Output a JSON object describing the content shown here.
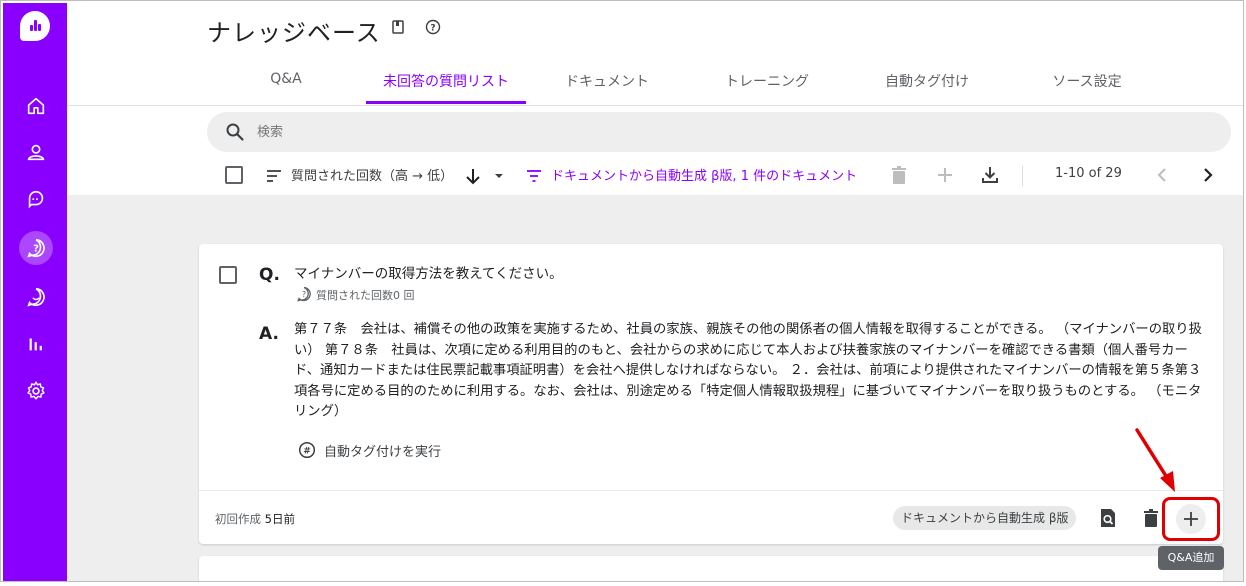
{
  "sidebar": {
    "items": [
      {
        "icon": "home-icon"
      },
      {
        "icon": "user-icon"
      },
      {
        "icon": "chat-icon"
      },
      {
        "icon": "question-icon"
      },
      {
        "icon": "smile-chat-icon"
      },
      {
        "icon": "chart-icon"
      },
      {
        "icon": "gear-icon"
      }
    ],
    "active_index": 3,
    "accent_color": "#8a00ff"
  },
  "header": {
    "title": "ナレッジベース",
    "tabs": [
      {
        "label": "Q&A"
      },
      {
        "label": "未回答の質問リスト"
      },
      {
        "label": "ドキュメント"
      },
      {
        "label": "トレーニング"
      },
      {
        "label": "自動タグ付け"
      },
      {
        "label": "ソース設定"
      }
    ],
    "active_tab": 1
  },
  "toolbar": {
    "search_placeholder": "検索",
    "sort_label": "質問された回数（高 → 低）",
    "filter_label": "ドキュメントから自動生成 β版, 1 件のドキュメント",
    "pagination": "1-10 of 29"
  },
  "card": {
    "q_mark": "Q.",
    "question": "マイナンバーの取得方法を教えてください。",
    "asked_count": "質問された回数0 回",
    "a_mark": "A.",
    "answer": "第７７条　会社は、補償その他の政策を実施するため、社員の家族、親族その他の関係者の個人情報を取得することができる。 （マイナンバーの取り扱い） 第７８条　社員は、次項に定める利用目的のもと、会社からの求めに応じて本人および扶養家族のマイナンバーを確認できる書類（個人番号カード、通知カードまたは住民票記載事項証明書）を会社へ提供しなければならない。 ２．会社は、前項により提供されたマイナンバーの情報を第５条第３項各号に定める目的のために利用する。なお、会社は、別途定める「特定個人情報取扱規程」に基づいてマイナンバーを取り扱うものとする。 （モニタリング）",
    "auto_tag_label": "自動タグ付けを実行",
    "created_label": "初回作成",
    "created_value": "5日前",
    "source_chip": "ドキュメントから自動生成 β版"
  },
  "tooltip": "Q&A追加"
}
